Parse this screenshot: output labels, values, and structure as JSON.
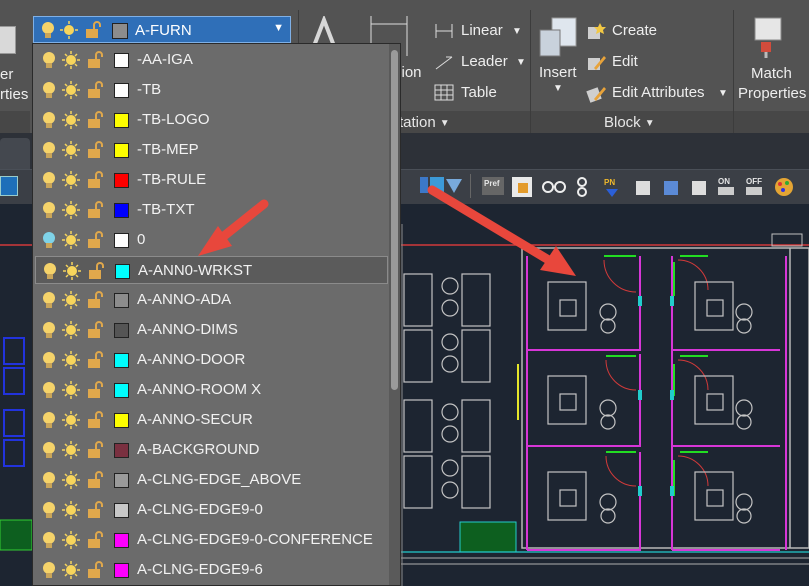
{
  "ribbon": {
    "left_partial_label_1": "er",
    "left_partial_label_2": "rties",
    "layer_combo": {
      "current_layer": "A-FURN",
      "swatch_color": "#8c8c8c"
    },
    "text_group": {
      "dimension_partial": "sion",
      "tation_partial": "tation"
    },
    "annotation": {
      "linear": "Linear",
      "leader": "Leader",
      "table": "Table",
      "panel_title": "tation"
    },
    "block": {
      "insert": "Insert",
      "create": "Create",
      "edit": "Edit",
      "edit_attributes": "Edit Attributes",
      "panel_title": "Block"
    },
    "match": {
      "line1": "Match",
      "line2": "Properties"
    }
  },
  "layers": [
    {
      "name": "-AA-IGA",
      "color": "#ffffff",
      "bulb": "yellow"
    },
    {
      "name": "-TB",
      "color": "#ffffff",
      "bulb": "yellow"
    },
    {
      "name": "-TB-LOGO",
      "color": "#ffff00",
      "bulb": "yellow"
    },
    {
      "name": "-TB-MEP",
      "color": "#ffff00",
      "bulb": "yellow"
    },
    {
      "name": "-TB-RULE",
      "color": "#ff0000",
      "bulb": "yellow"
    },
    {
      "name": "-TB-TXT",
      "color": "#0000ff",
      "bulb": "yellow"
    },
    {
      "name": "0",
      "color": "#ffffff",
      "bulb": "blue"
    },
    {
      "name": "A-ANN0-WRKST",
      "color": "#00ffff",
      "bulb": "yellow",
      "selected": true
    },
    {
      "name": "A-ANNO-ADA",
      "color": "#8c8c8c",
      "bulb": "yellow"
    },
    {
      "name": "A-ANNO-DIMS",
      "color": "#555555",
      "bulb": "yellow"
    },
    {
      "name": "A-ANNO-DOOR",
      "color": "#00ffff",
      "bulb": "yellow"
    },
    {
      "name": "A-ANNO-ROOM X",
      "color": "#00ffff",
      "bulb": "yellow"
    },
    {
      "name": "A-ANNO-SECUR",
      "color": "#ffff00",
      "bulb": "yellow"
    },
    {
      "name": "A-BACKGROUND",
      "color": "#7a3040",
      "bulb": "yellow"
    },
    {
      "name": "A-CLNG-EDGE_ABOVE",
      "color": "#9a9a9a",
      "bulb": "yellow"
    },
    {
      "name": "A-CLNG-EDGE9-0",
      "color": "#c8c8c8",
      "bulb": "yellow"
    },
    {
      "name": "A-CLNG-EDGE9-0-CONFERENCE",
      "color": "#ff00ff",
      "bulb": "yellow"
    },
    {
      "name": "A-CLNG-EDGE9-6",
      "color": "#ff00ff",
      "bulb": "yellow"
    }
  ],
  "colors": {
    "accent": "#2f6fb8",
    "annotation_arrow": "#e8473c",
    "drawing_bg": "#1d2531"
  }
}
